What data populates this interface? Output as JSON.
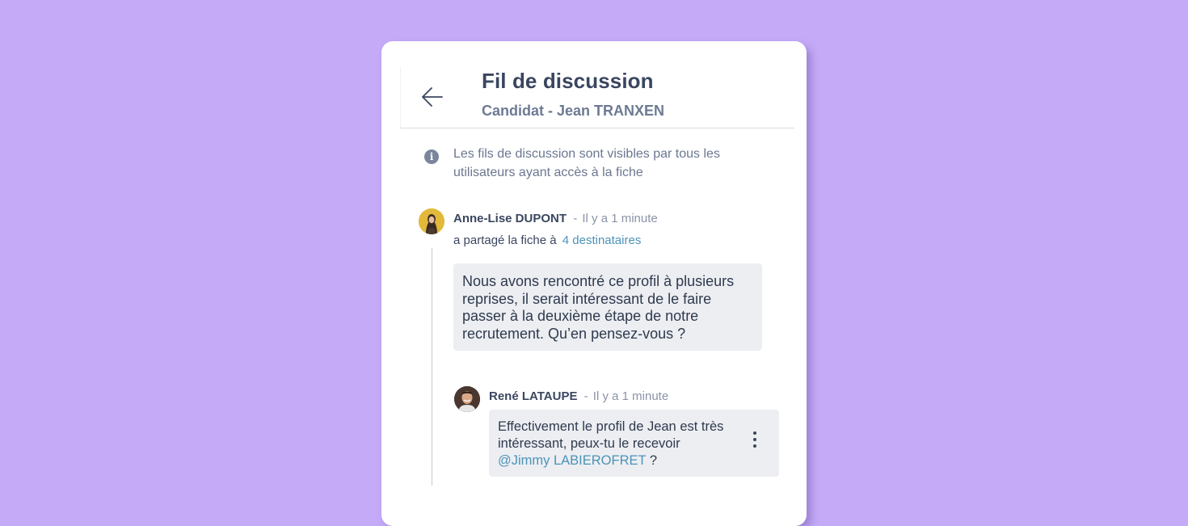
{
  "header": {
    "title": "Fil de discussion",
    "subtitle": "Candidat - Jean TRANXEN",
    "back_icon": "arrow-left-icon"
  },
  "info": {
    "icon": "info-icon",
    "glyph": "i",
    "text": "Les fils de discussion sont visibles par tous les utilisateurs ayant accès à la fiche"
  },
  "thread": {
    "author": "Anne-Lise DUPONT",
    "separator": "-",
    "time": "Il y a 1 minute",
    "action": "a partagé la fiche à",
    "recipients": "4 destinataires",
    "message": "Nous avons rencontré ce profil à plusieurs reprises, il serait intéressant de le faire passer à la deuxième étape de notre recrutement. Qu’en pensez-vous ?"
  },
  "reply": {
    "author": "René LATAUPE",
    "separator": "-",
    "time": "Il y a 1 minute",
    "message_before": "Effectivement le profil de Jean est très intéressant,  peux-tu le recevoir",
    "mention": "@Jimmy LABIEROFRET",
    "message_after": " ?",
    "menu_icon": "more-vertical-icon"
  },
  "colors": {
    "background": "#c4aaf7",
    "card": "#ffffff",
    "link": "#4d93b8",
    "bubble": "#eceef2"
  }
}
